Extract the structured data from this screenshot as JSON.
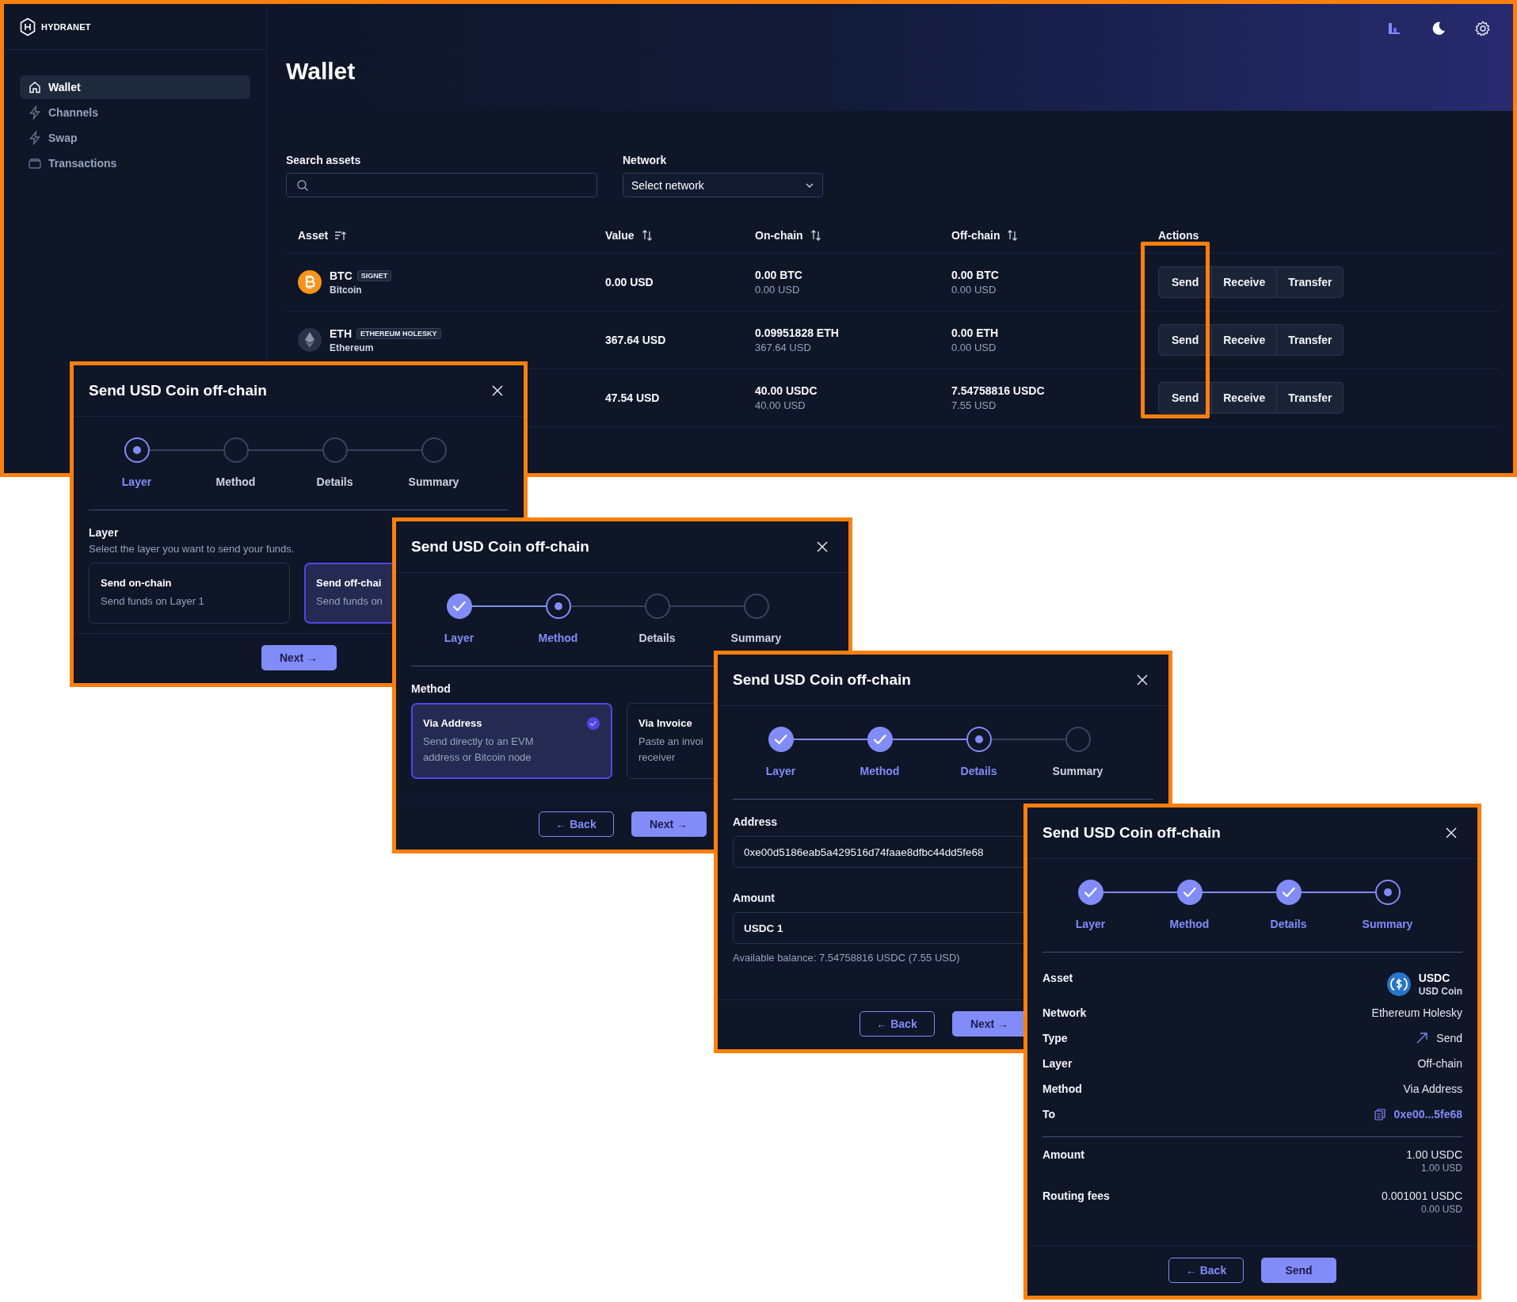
{
  "app": {
    "logo": "HYDRANET",
    "nav": [
      {
        "label": "Wallet",
        "selected": true
      },
      {
        "label": "Channels",
        "selected": false
      },
      {
        "label": "Swap",
        "selected": false
      },
      {
        "label": "Transactions",
        "selected": false
      }
    ]
  },
  "page": {
    "title": "Wallet"
  },
  "filters": {
    "search_label": "Search assets",
    "network_label": "Network",
    "network_value": "Select network"
  },
  "table": {
    "columns": [
      {
        "label": "Asset",
        "sortable": true,
        "sorted": true
      },
      {
        "label": "Value",
        "sortable": true,
        "sorted": false
      },
      {
        "label": "On-chain",
        "sortable": true,
        "sorted": false
      },
      {
        "label": "Off-chain",
        "sortable": true,
        "sorted": false
      },
      {
        "label": "Actions",
        "sortable": false
      }
    ],
    "rows": [
      {
        "asset": {
          "symbol": "BTC",
          "tag": "SIGNET",
          "name": "Bitcoin"
        },
        "value": "0.00 USD",
        "on_chain": {
          "amount": "0.00 BTC",
          "fiat": "0.00 USD"
        },
        "off_chain": {
          "amount": "0.00 BTC",
          "fiat": "0.00 USD"
        },
        "actions": [
          "Send",
          "Receive",
          "Transfer"
        ]
      },
      {
        "asset": {
          "symbol": "ETH",
          "tag": "ETHEREUM HOLESKY",
          "name": "Ethereum"
        },
        "value": "367.64 USD",
        "on_chain": {
          "amount": "0.09951828 ETH",
          "fiat": "367.64 USD"
        },
        "off_chain": {
          "amount": "0.00 ETH",
          "fiat": "0.00 USD"
        },
        "actions": [
          "Send",
          "Receive",
          "Transfer"
        ]
      },
      {
        "value": "47.54 USD",
        "on_chain": {
          "amount": "40.00 USDC",
          "fiat": "40.00 USD"
        },
        "off_chain": {
          "amount": "7.54758816 USDC",
          "fiat": "7.55 USD"
        },
        "actions": [
          "Send",
          "Receive",
          "Transfer"
        ]
      }
    ]
  },
  "dialogs": [
    {
      "title": "Send USD Coin off-chain",
      "steps": [
        {
          "label": "Layer",
          "done": false,
          "current": true
        },
        {
          "label": "Method",
          "done": false,
          "current": false
        },
        {
          "label": "Details",
          "done": false,
          "current": false
        },
        {
          "label": "Summary",
          "done": false,
          "current": false
        }
      ],
      "body": {
        "kind": "options",
        "heading": "Layer",
        "description": "Select the layer you want to send your funds.",
        "options": [
          {
            "title": "Send on-chain",
            "lines": [
              "Send funds on Layer 1"
            ],
            "selected": false
          },
          {
            "title": "Send off-chai",
            "lines": [
              "Send funds on"
            ],
            "selected": true
          }
        ]
      },
      "buttons": [
        {
          "label": "Next →",
          "kind": "primary"
        }
      ]
    },
    {
      "title": "Send USD Coin off-chain",
      "steps": [
        {
          "label": "Layer",
          "done": true,
          "current": false
        },
        {
          "label": "Method",
          "done": false,
          "current": true
        },
        {
          "label": "Details",
          "done": false,
          "current": false
        },
        {
          "label": "Summary",
          "done": false,
          "current": false
        }
      ],
      "body": {
        "kind": "options",
        "heading": "Method",
        "options": [
          {
            "title": "Via Address",
            "lines": [
              "Send directly to an EVM",
              "address or Bitcoin node"
            ],
            "selected": true,
            "checkmark": true
          },
          {
            "title": "Via Invoice",
            "lines": [
              "Paste an invoi",
              "receiver"
            ],
            "selected": false
          }
        ]
      },
      "buttons": [
        {
          "label": "← Back",
          "kind": "secondary"
        },
        {
          "label": "Next →",
          "kind": "primary"
        }
      ]
    },
    {
      "title": "Send USD Coin off-chain",
      "steps": [
        {
          "label": "Layer",
          "done": true,
          "current": false
        },
        {
          "label": "Method",
          "done": true,
          "current": false
        },
        {
          "label": "Details",
          "done": false,
          "current": true
        },
        {
          "label": "Summary",
          "done": false,
          "current": false
        }
      ],
      "body": {
        "kind": "form",
        "fields": [
          {
            "label": "Address",
            "value": "0xe00d5186eab5a429516d74faae8dfbc44dd5fe68"
          },
          {
            "label": "Amount",
            "value": "USDC 1",
            "hint": "Available balance: 7.54758816 USDC (7.55 USD)"
          }
        ]
      },
      "buttons": [
        {
          "label": "← Back",
          "kind": "secondary"
        },
        {
          "label": "Next →",
          "kind": "primary"
        }
      ]
    },
    {
      "title": "Send USD Coin off-chain",
      "steps": [
        {
          "label": "Layer",
          "done": true,
          "current": false
        },
        {
          "label": "Method",
          "done": true,
          "current": false
        },
        {
          "label": "Details",
          "done": true,
          "current": false
        },
        {
          "label": "Summary",
          "done": false,
          "current": true
        }
      ],
      "body": {
        "kind": "summary",
        "rows": [
          {
            "label": "Asset",
            "kind": "asset",
            "value": "USDC",
            "sub": "USD Coin"
          },
          {
            "label": "Network",
            "kind": "plain",
            "value": "Ethereum Holesky"
          },
          {
            "label": "Type",
            "kind": "send",
            "value": "Send"
          },
          {
            "label": "Layer",
            "kind": "plain",
            "value": "Off-chain"
          },
          {
            "label": "Method",
            "kind": "plain",
            "value": "Via Address"
          },
          {
            "label": "To",
            "kind": "address",
            "value": "0xe00...5fe68"
          }
        ],
        "amounts": [
          {
            "label": "Amount",
            "value": "1.00 USDC",
            "sub": "1.00 USD"
          },
          {
            "label": "Routing fees",
            "value": "0.001001 USDC",
            "sub": "0.00 USD"
          }
        ]
      },
      "buttons": [
        {
          "label": "← Back",
          "kind": "secondary"
        },
        {
          "label": "Send",
          "kind": "primary"
        }
      ]
    }
  ]
}
